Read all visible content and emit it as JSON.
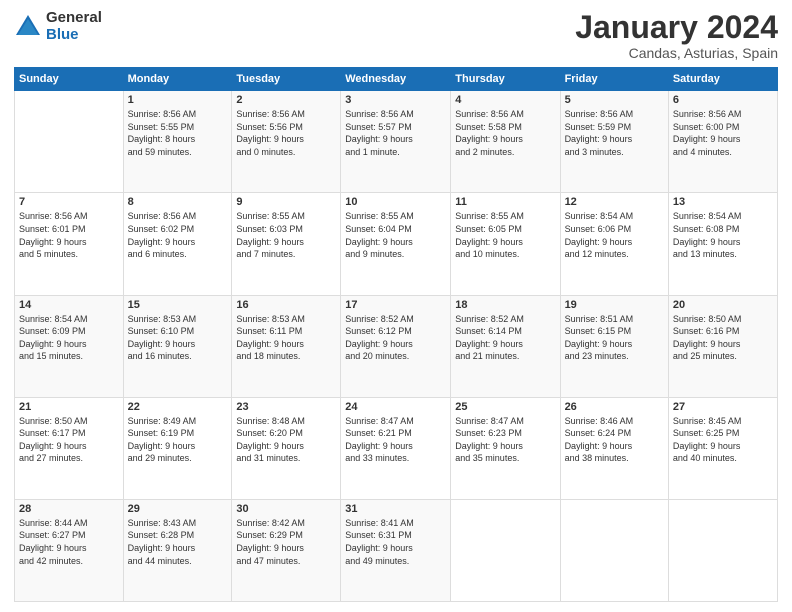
{
  "logo": {
    "general": "General",
    "blue": "Blue"
  },
  "header": {
    "title": "January 2024",
    "location": "Candas, Asturias, Spain"
  },
  "days_of_week": [
    "Sunday",
    "Monday",
    "Tuesday",
    "Wednesday",
    "Thursday",
    "Friday",
    "Saturday"
  ],
  "weeks": [
    [
      {
        "day": "",
        "info": ""
      },
      {
        "day": "1",
        "info": "Sunrise: 8:56 AM\nSunset: 5:55 PM\nDaylight: 8 hours\nand 59 minutes."
      },
      {
        "day": "2",
        "info": "Sunrise: 8:56 AM\nSunset: 5:56 PM\nDaylight: 9 hours\nand 0 minutes."
      },
      {
        "day": "3",
        "info": "Sunrise: 8:56 AM\nSunset: 5:57 PM\nDaylight: 9 hours\nand 1 minute."
      },
      {
        "day": "4",
        "info": "Sunrise: 8:56 AM\nSunset: 5:58 PM\nDaylight: 9 hours\nand 2 minutes."
      },
      {
        "day": "5",
        "info": "Sunrise: 8:56 AM\nSunset: 5:59 PM\nDaylight: 9 hours\nand 3 minutes."
      },
      {
        "day": "6",
        "info": "Sunrise: 8:56 AM\nSunset: 6:00 PM\nDaylight: 9 hours\nand 4 minutes."
      }
    ],
    [
      {
        "day": "7",
        "info": "Sunrise: 8:56 AM\nSunset: 6:01 PM\nDaylight: 9 hours\nand 5 minutes."
      },
      {
        "day": "8",
        "info": "Sunrise: 8:56 AM\nSunset: 6:02 PM\nDaylight: 9 hours\nand 6 minutes."
      },
      {
        "day": "9",
        "info": "Sunrise: 8:55 AM\nSunset: 6:03 PM\nDaylight: 9 hours\nand 7 minutes."
      },
      {
        "day": "10",
        "info": "Sunrise: 8:55 AM\nSunset: 6:04 PM\nDaylight: 9 hours\nand 9 minutes."
      },
      {
        "day": "11",
        "info": "Sunrise: 8:55 AM\nSunset: 6:05 PM\nDaylight: 9 hours\nand 10 minutes."
      },
      {
        "day": "12",
        "info": "Sunrise: 8:54 AM\nSunset: 6:06 PM\nDaylight: 9 hours\nand 12 minutes."
      },
      {
        "day": "13",
        "info": "Sunrise: 8:54 AM\nSunset: 6:08 PM\nDaylight: 9 hours\nand 13 minutes."
      }
    ],
    [
      {
        "day": "14",
        "info": "Sunrise: 8:54 AM\nSunset: 6:09 PM\nDaylight: 9 hours\nand 15 minutes."
      },
      {
        "day": "15",
        "info": "Sunrise: 8:53 AM\nSunset: 6:10 PM\nDaylight: 9 hours\nand 16 minutes."
      },
      {
        "day": "16",
        "info": "Sunrise: 8:53 AM\nSunset: 6:11 PM\nDaylight: 9 hours\nand 18 minutes."
      },
      {
        "day": "17",
        "info": "Sunrise: 8:52 AM\nSunset: 6:12 PM\nDaylight: 9 hours\nand 20 minutes."
      },
      {
        "day": "18",
        "info": "Sunrise: 8:52 AM\nSunset: 6:14 PM\nDaylight: 9 hours\nand 21 minutes."
      },
      {
        "day": "19",
        "info": "Sunrise: 8:51 AM\nSunset: 6:15 PM\nDaylight: 9 hours\nand 23 minutes."
      },
      {
        "day": "20",
        "info": "Sunrise: 8:50 AM\nSunset: 6:16 PM\nDaylight: 9 hours\nand 25 minutes."
      }
    ],
    [
      {
        "day": "21",
        "info": "Sunrise: 8:50 AM\nSunset: 6:17 PM\nDaylight: 9 hours\nand 27 minutes."
      },
      {
        "day": "22",
        "info": "Sunrise: 8:49 AM\nSunset: 6:19 PM\nDaylight: 9 hours\nand 29 minutes."
      },
      {
        "day": "23",
        "info": "Sunrise: 8:48 AM\nSunset: 6:20 PM\nDaylight: 9 hours\nand 31 minutes."
      },
      {
        "day": "24",
        "info": "Sunrise: 8:47 AM\nSunset: 6:21 PM\nDaylight: 9 hours\nand 33 minutes."
      },
      {
        "day": "25",
        "info": "Sunrise: 8:47 AM\nSunset: 6:23 PM\nDaylight: 9 hours\nand 35 minutes."
      },
      {
        "day": "26",
        "info": "Sunrise: 8:46 AM\nSunset: 6:24 PM\nDaylight: 9 hours\nand 38 minutes."
      },
      {
        "day": "27",
        "info": "Sunrise: 8:45 AM\nSunset: 6:25 PM\nDaylight: 9 hours\nand 40 minutes."
      }
    ],
    [
      {
        "day": "28",
        "info": "Sunrise: 8:44 AM\nSunset: 6:27 PM\nDaylight: 9 hours\nand 42 minutes."
      },
      {
        "day": "29",
        "info": "Sunrise: 8:43 AM\nSunset: 6:28 PM\nDaylight: 9 hours\nand 44 minutes."
      },
      {
        "day": "30",
        "info": "Sunrise: 8:42 AM\nSunset: 6:29 PM\nDaylight: 9 hours\nand 47 minutes."
      },
      {
        "day": "31",
        "info": "Sunrise: 8:41 AM\nSunset: 6:31 PM\nDaylight: 9 hours\nand 49 minutes."
      },
      {
        "day": "",
        "info": ""
      },
      {
        "day": "",
        "info": ""
      },
      {
        "day": "",
        "info": ""
      }
    ]
  ]
}
